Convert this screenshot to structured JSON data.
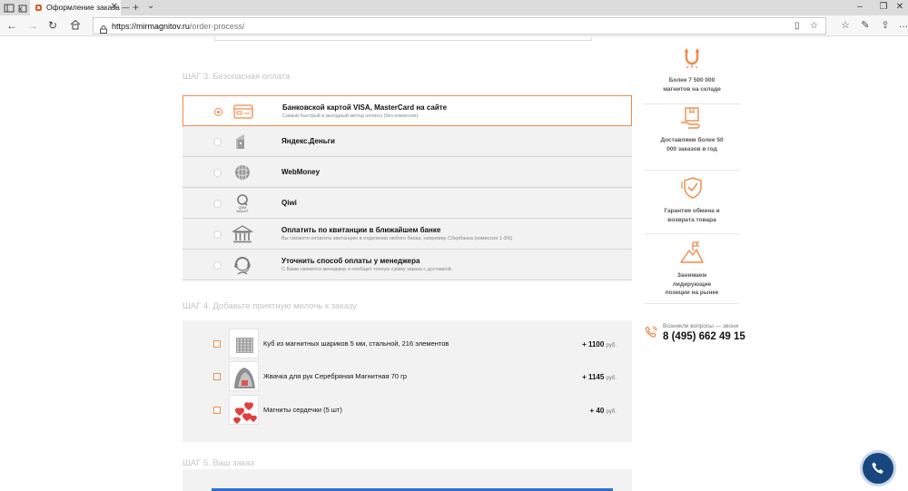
{
  "browser": {
    "tab_title": "Оформление заказа —",
    "url_host": "https://mirmagnitov.ru",
    "url_path": "/order-process/"
  },
  "step3": {
    "title": "ШАГ 3. Безопасная оплата",
    "selected_index": 0,
    "options": [
      {
        "name": "Банковской картой VISA, MasterCard на сайте",
        "desc": "Самый быстрый и выгодный метод оплаты (без комиссии)",
        "icon": "credit-card-icon"
      },
      {
        "name": "Яндекс.Деньги",
        "desc": "",
        "icon": "yandex-money-icon"
      },
      {
        "name": "WebMoney",
        "desc": "",
        "icon": "webmoney-icon"
      },
      {
        "name": "Qiwi",
        "desc": "",
        "icon": "qiwi-icon",
        "icon_text": "QIWI WALLET"
      },
      {
        "name": "Оплатить по квитанции в ближайшем банке",
        "desc": "Вы сможете оплатить квитанцию в отделении любого банка, например Сбербанка (комиссия 1-3%)",
        "icon": "bank-icon"
      },
      {
        "name": "Уточнить способ оплаты у менеджера",
        "desc": "С Вами свяжется менеджер и сообщит точную сумму заказа с доставкой.",
        "icon": "manager-headset-icon"
      }
    ]
  },
  "step4": {
    "title": "ШАГ 4. Добавьте приятную мелочь к заказу",
    "items": [
      {
        "name": "Куб из магнитных шариков 5 мм, стальной, 216 элементов",
        "price": "+ 1100",
        "currency": "руб."
      },
      {
        "name": "Жвачка для рук Серебряная Магнитная 70 гр",
        "price": "+ 1145",
        "currency": "руб."
      },
      {
        "name": "Магниты сердечки (5 шт)",
        "price": "+ 40",
        "currency": "руб."
      }
    ]
  },
  "step5": {
    "title": "ШАГ 5. Ваш заказ"
  },
  "sidebar": {
    "benefits": [
      {
        "text": "Более 7 500 000 магнитов на складе",
        "icon": "magnet-icon"
      },
      {
        "text": "Доставляем более 50 000 заказов в год",
        "icon": "delivery-box-icon"
      },
      {
        "text": "Гарантия обмена и возврата товара",
        "icon": "shield-check-icon"
      },
      {
        "text": "Занимаем лидирующие позиции на рынке",
        "icon": "mountain-flag-icon"
      }
    ],
    "phone_caption": "Возникли вопросы — звони",
    "phone_number": "8 (495) 662 49 15"
  },
  "colors": {
    "accent": "#f08a4b",
    "call_button": "#17477e",
    "order_bar": "#2f6fd0"
  }
}
